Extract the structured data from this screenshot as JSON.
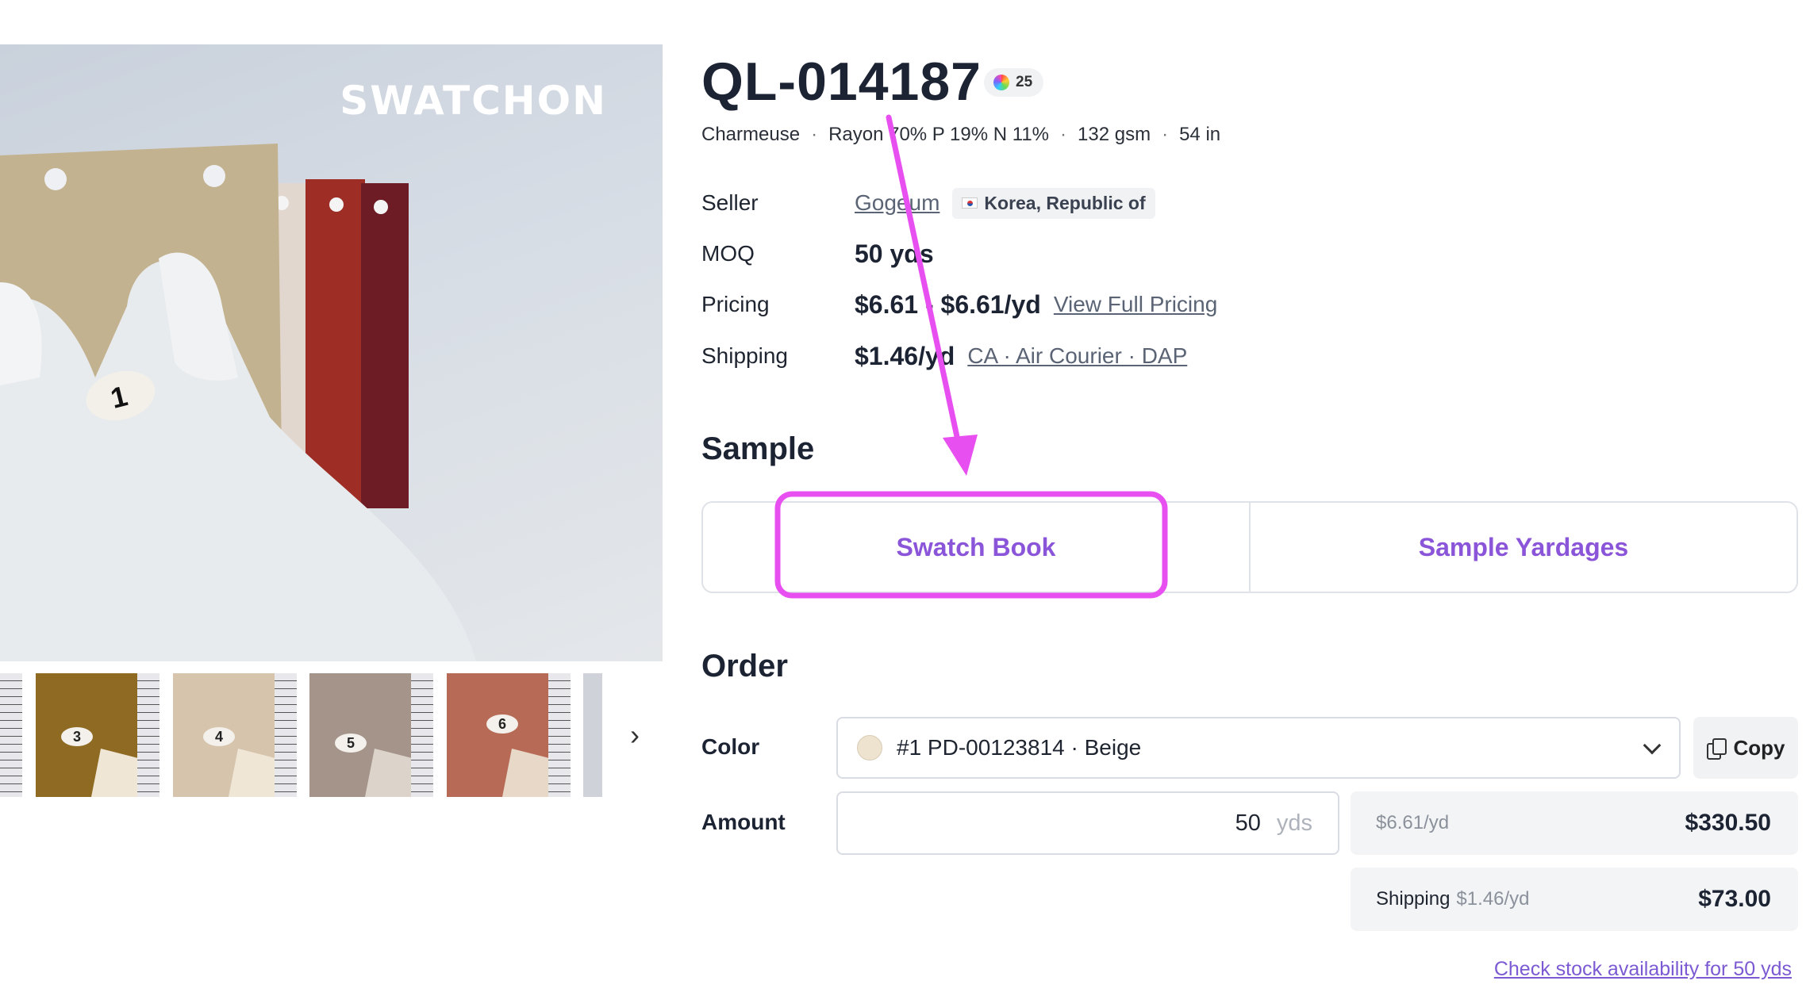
{
  "gallery": {
    "brand_text": "SWATCHON",
    "main_swatch_number": "1",
    "thumbnails": [
      {
        "number": "3",
        "color": "#8e6a22"
      },
      {
        "number": "4",
        "color": "#d6c4ac"
      },
      {
        "number": "5",
        "color": "#a4948a"
      },
      {
        "number": "6",
        "color": "#b76b57"
      }
    ]
  },
  "product": {
    "code": "QL-014187",
    "color_count": "25",
    "specs": [
      "Charmeuse",
      "Rayon 70% P 19% N 11%",
      "132 gsm",
      "54 in"
    ]
  },
  "info": {
    "seller_label": "Seller",
    "seller_name": "Gogeum",
    "country": "Korea, Republic of",
    "moq_label": "MOQ",
    "moq_value": "50 yds",
    "pricing_label": "Pricing",
    "pricing_value": "$6.61 - $6.61/yd",
    "pricing_link": "View Full Pricing",
    "shipping_label": "Shipping",
    "shipping_value": "$1.46/yd",
    "shipping_link": "CA · Air Courier · DAP"
  },
  "sample": {
    "title": "Sample",
    "tabs": [
      "Swatch Book",
      "Sample Yardages"
    ]
  },
  "order": {
    "title": "Order",
    "color_label": "Color",
    "color_value": "#1 PD-00123814 · Beige",
    "copy_label": "Copy",
    "amount_label": "Amount",
    "amount_value": "50",
    "amount_unit": "yds",
    "unit_price": "$6.61/yd",
    "subtotal": "$330.50",
    "shipping_label": "Shipping",
    "shipping_rate": "$1.46/yd",
    "shipping_total": "$73.00",
    "stock_link": "Check stock availability for 50 yds"
  },
  "colors": {
    "accent": "#8a55d8",
    "annotation": "#e84ff0"
  }
}
